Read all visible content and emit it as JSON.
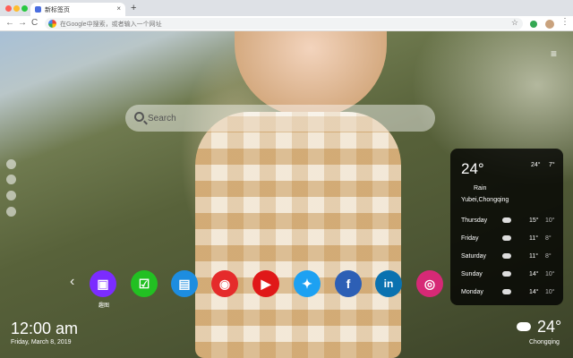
{
  "browser": {
    "tab_title": "新标签页",
    "tab_close": "×",
    "new_tab": "+",
    "back": "←",
    "forward": "→",
    "reload": "C",
    "omnibox_placeholder": "在Google中搜索，或者输入一个网址",
    "star": "☆",
    "kebab": "⋮"
  },
  "page": {
    "menu": "≡",
    "search_placeholder": "Search",
    "prev": "‹",
    "apps": [
      {
        "icon": "photo-editor-icon",
        "color": "#7b2cff",
        "label": "趣图"
      },
      {
        "icon": "checkbox-app-icon",
        "color": "#22c022",
        "label": ""
      },
      {
        "icon": "notes-app-icon",
        "color": "#1d8de0",
        "label": ""
      },
      {
        "icon": "game-app-icon",
        "color": "#e52b2b",
        "label": ""
      },
      {
        "icon": "youtube-icon",
        "color": "#e01818",
        "label": ""
      },
      {
        "icon": "twitter-icon",
        "color": "#1da1f2",
        "label": ""
      },
      {
        "icon": "facebook-icon",
        "color": "#2d5fb5",
        "label": ""
      },
      {
        "icon": "linkedin-icon",
        "color": "#0a72b0",
        "label": ""
      },
      {
        "icon": "instagram-icon",
        "color": "#d62976",
        "label": ""
      }
    ]
  },
  "weather": {
    "temp": "24°",
    "high": "24°",
    "low": "7°",
    "condition": "Rain",
    "location": "Yubei,Chongqing",
    "forecast": [
      {
        "day": "Thursday",
        "high": "15°",
        "low": "10°"
      },
      {
        "day": "Friday",
        "high": "11°",
        "low": "8°"
      },
      {
        "day": "Saturday",
        "high": "11°",
        "low": "8°"
      },
      {
        "day": "Sunday",
        "high": "14°",
        "low": "10°"
      },
      {
        "day": "Monday",
        "high": "14°",
        "low": "10°"
      }
    ]
  },
  "clock": {
    "time": "12:00 am",
    "date": "Friday, March 8, 2019"
  },
  "bottom_weather": {
    "temp": "24°",
    "city": "Chongqing"
  }
}
